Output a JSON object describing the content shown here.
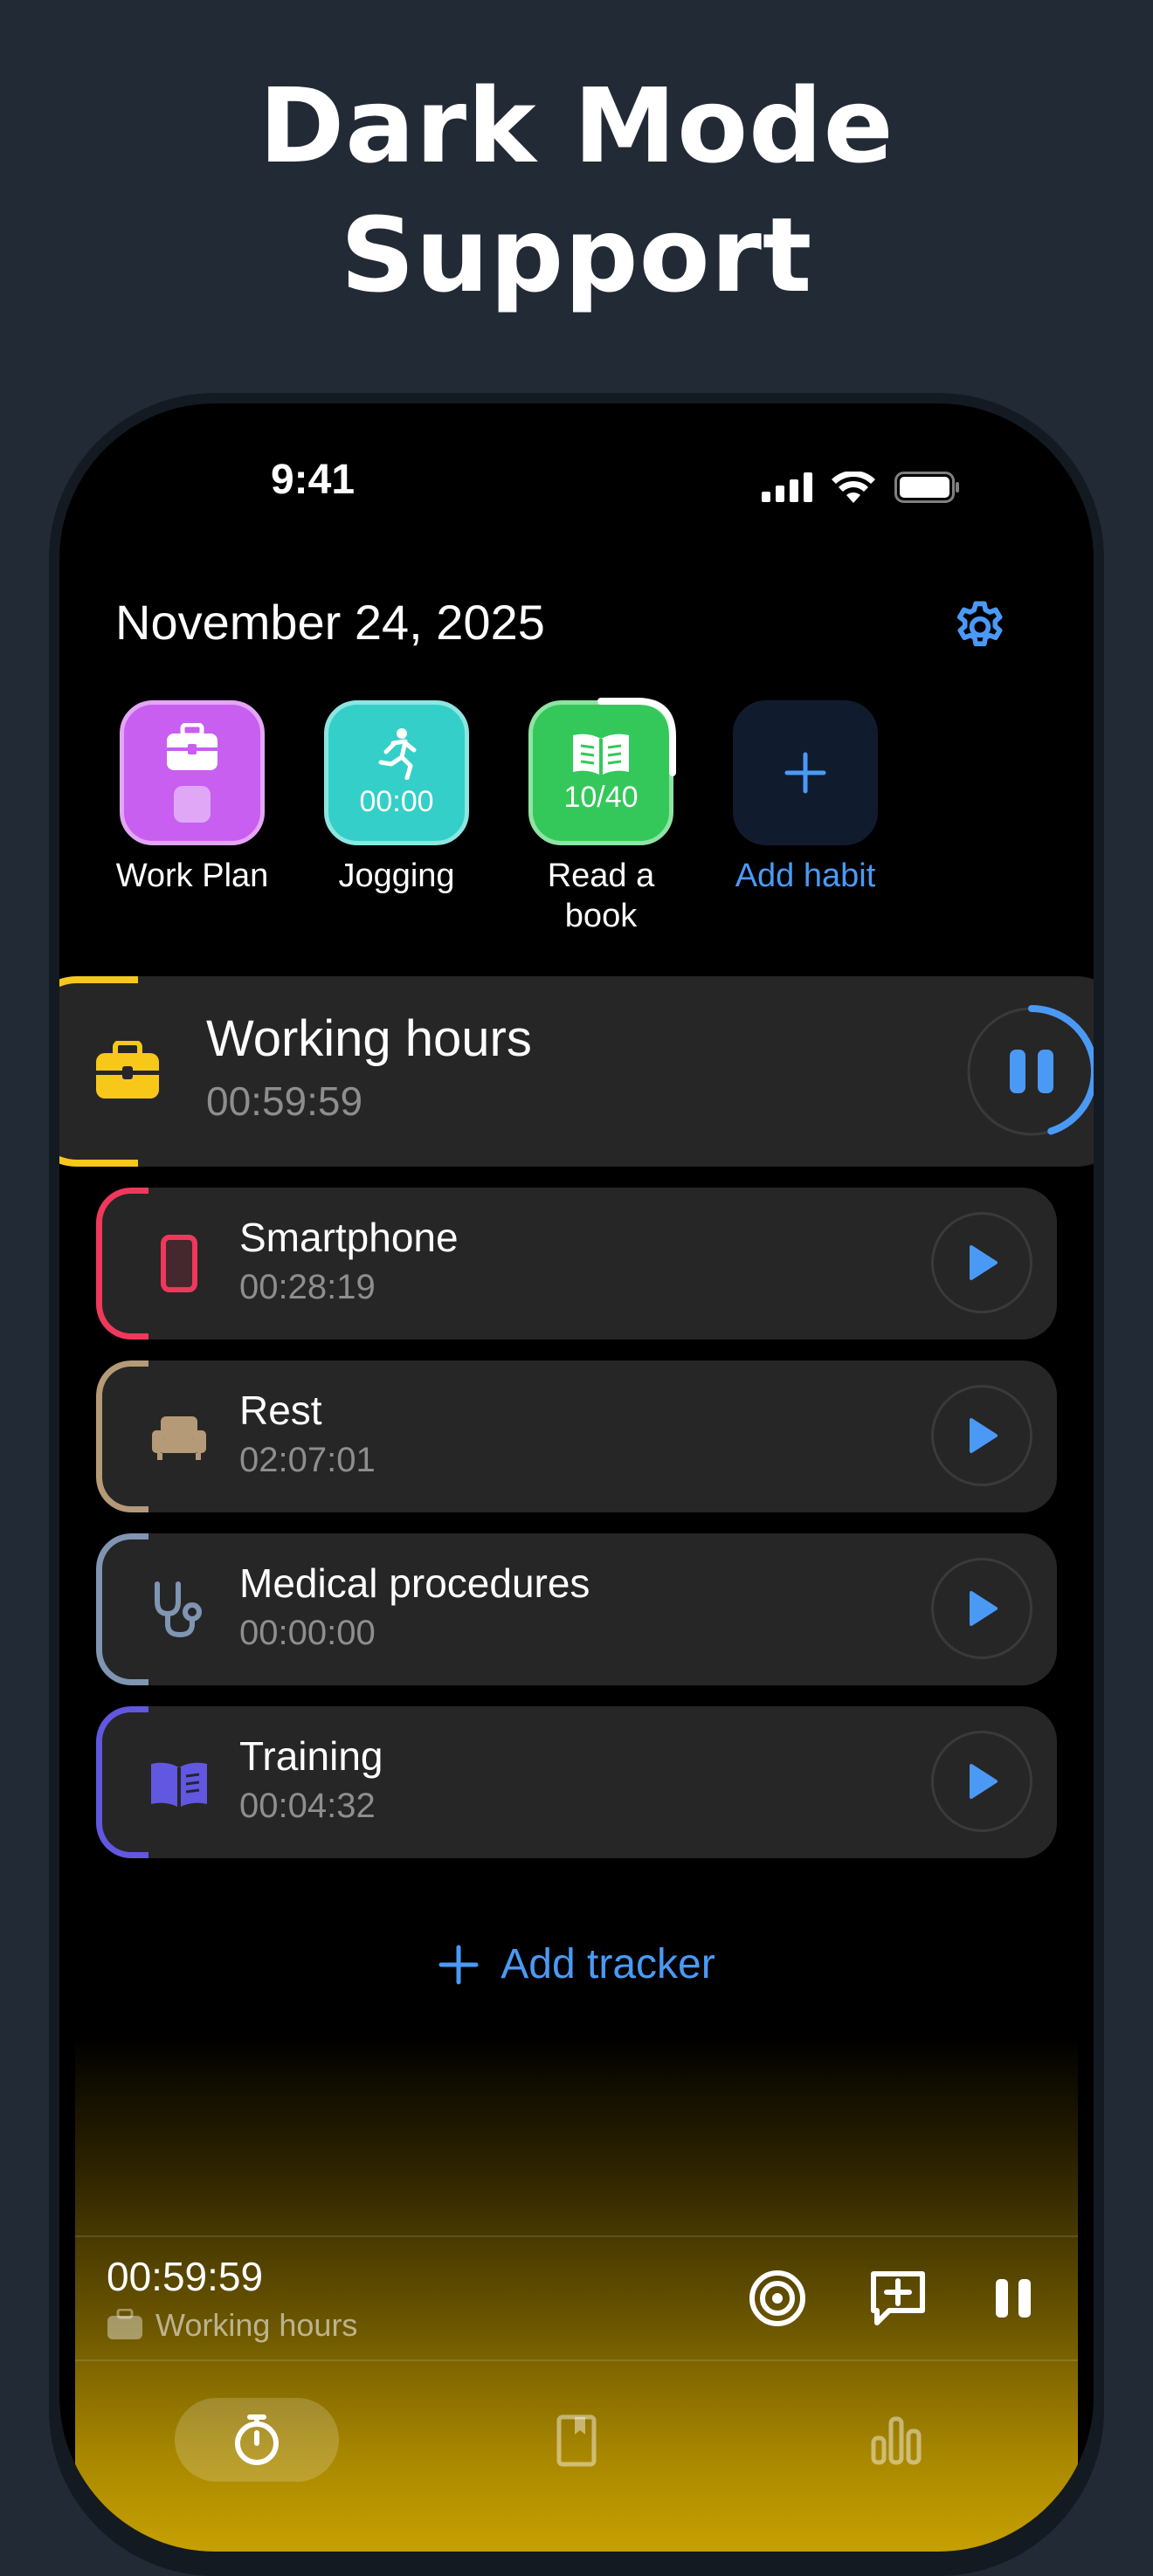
{
  "headline": {
    "line1": "Dark Mode",
    "line2": "Support"
  },
  "status_bar": {
    "time": "9:41"
  },
  "header": {
    "date": "November 24, 2025"
  },
  "habits": [
    {
      "label": "Work Plan",
      "value": "",
      "color": "#c85ff0"
    },
    {
      "label": "Jogging",
      "value": "00:00",
      "color": "#34cfc8"
    },
    {
      "label": "Read a book",
      "value": "10/40",
      "color": "#34c85a",
      "progress": 0.25
    },
    {
      "label": "Add habit",
      "value": "",
      "color": "#4a9af5"
    }
  ],
  "active_tracker": {
    "name": "Working hours",
    "time": "00:59:59",
    "accent": "#f7c81a",
    "progress": 0.45
  },
  "trackers": [
    {
      "name": "Smartphone",
      "time": "00:28:19",
      "accent": "#f0385c",
      "icon": "smartphone-icon"
    },
    {
      "name": "Rest",
      "time": "02:07:01",
      "accent": "#b59a78",
      "icon": "armchair-icon"
    },
    {
      "name": "Medical procedures",
      "time": "00:00:00",
      "accent": "#7f95b2",
      "icon": "stethoscope-icon"
    },
    {
      "name": "Training",
      "time": "00:04:32",
      "accent": "#6157e0",
      "icon": "book-open-icon"
    }
  ],
  "add_tracker": {
    "label": "Add tracker"
  },
  "mini_player": {
    "time": "00:59:59",
    "label": "Working hours"
  },
  "colors": {
    "accent_blue": "#4a9af5",
    "background": "#222a36"
  }
}
